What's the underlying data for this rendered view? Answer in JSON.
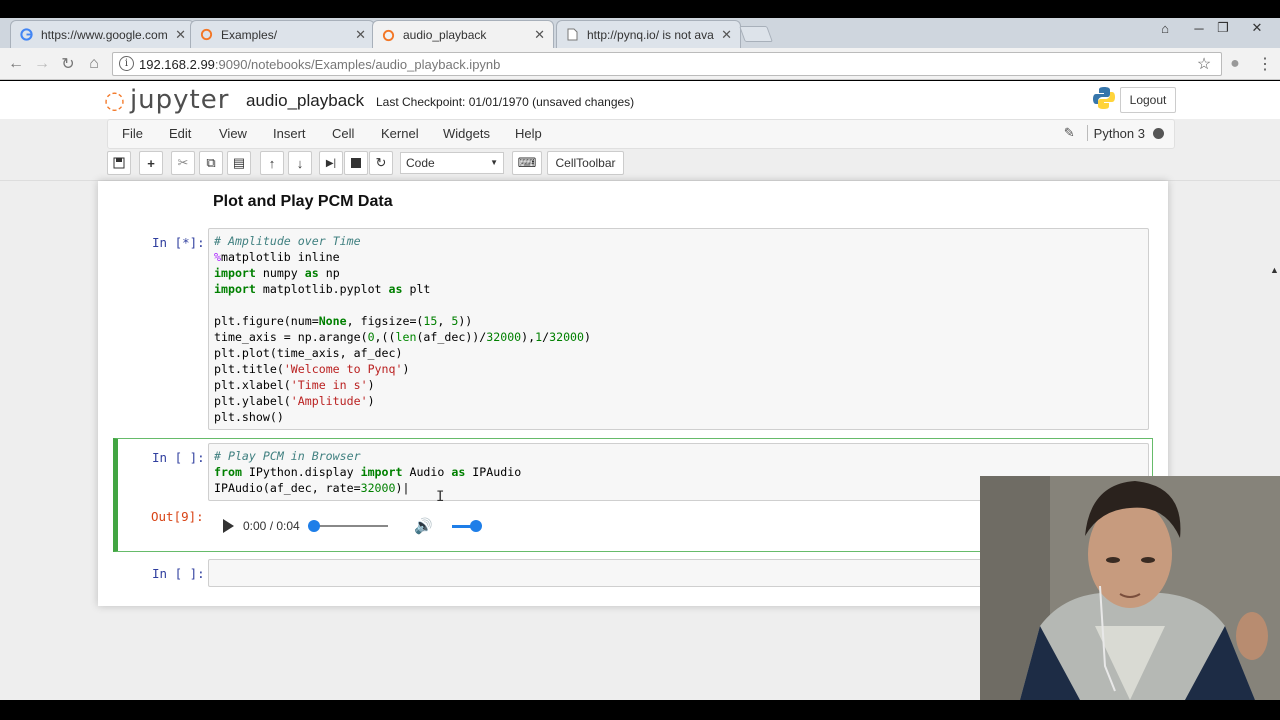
{
  "browser": {
    "tabs": [
      {
        "title": "https://www.google.com",
        "icon": "google-icon",
        "active": false
      },
      {
        "title": "Examples/",
        "icon": "jupyter-favicon",
        "active": false
      },
      {
        "title": "audio_playback",
        "icon": "jupyter-favicon",
        "active": true
      },
      {
        "title": "http://pynq.io/ is not ava",
        "icon": "page-icon",
        "active": false
      }
    ],
    "address": {
      "host": "192.168.2.99",
      "path": ":9090/notebooks/Examples/audio_playback.ipynb"
    }
  },
  "jupyter": {
    "logo_text": "jupyter",
    "notebook_name": "audio_playback",
    "checkpoint": "Last Checkpoint: 01/01/1970 (unsaved changes)",
    "logout_label": "Logout",
    "menus": [
      "File",
      "Edit",
      "View",
      "Insert",
      "Cell",
      "Kernel",
      "Widgets",
      "Help"
    ],
    "kernel_name": "Python 3",
    "cell_type": "Code",
    "celltoolbar_label": "CellToolbar"
  },
  "notebook": {
    "heading": "Plot and Play PCM Data",
    "cells": [
      {
        "prompt": "In [*]:"
      },
      {
        "prompt": "In [ ]:",
        "output_prompt": "Out[9]:"
      },
      {
        "prompt": "In [ ]:"
      }
    ],
    "audio": {
      "time": "0:00 / 0:04",
      "progress": 0.0,
      "volume": 1.0
    }
  },
  "colors": {
    "accent_orange": "#f37726",
    "prompt_in": "#303f9f",
    "prompt_out": "#d84315",
    "selected_cell": "#42a542",
    "audio_blue": "#1e7ee8"
  }
}
